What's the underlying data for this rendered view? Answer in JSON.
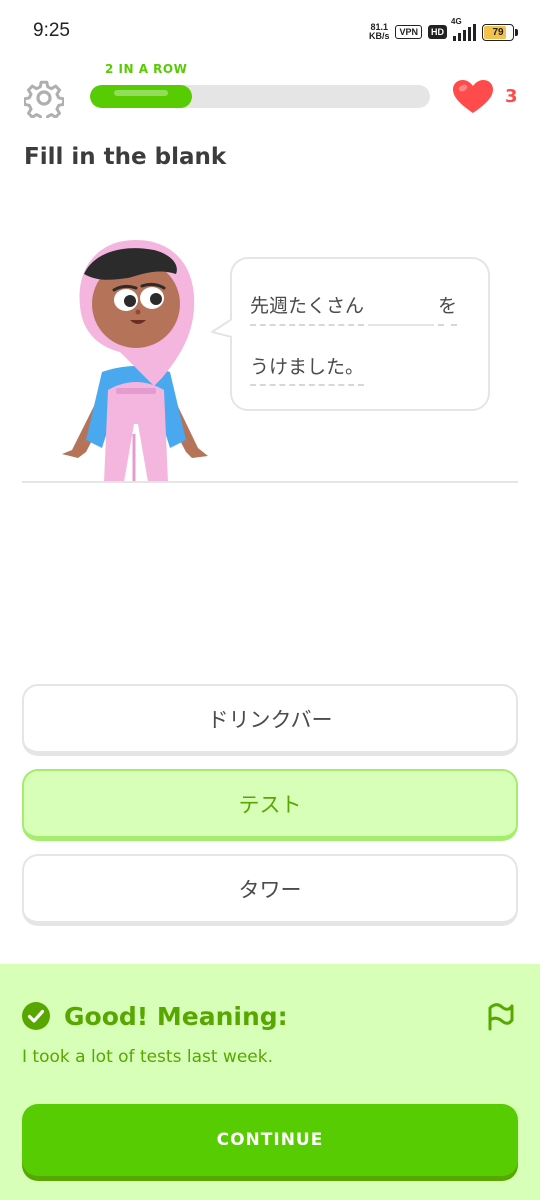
{
  "status_bar": {
    "time": "9:25",
    "net_speed_top": "81.1",
    "net_speed_bottom": "KB/s",
    "vpn": "VPN",
    "hd": "HD",
    "network": "4G",
    "battery": "79"
  },
  "lesson": {
    "streak_label": "2 IN A ROW",
    "progress": 0.3,
    "lives": "3",
    "title": "Fill in the blank"
  },
  "bubble": {
    "line1_before": "先週たくさん",
    "line1_after": "を",
    "line2": "うけました。"
  },
  "options": [
    {
      "label": "ドリンクバー",
      "selected": false
    },
    {
      "label": "テスト",
      "selected": true
    },
    {
      "label": "タワー",
      "selected": false
    }
  ],
  "feedback": {
    "title": "Good! Meaning:",
    "meaning": "I took a lot of tests last week.",
    "continue_label": "CONTINUE"
  },
  "colors": {
    "brand_green": "#58cc02",
    "feedback_bg": "#d7ffb8",
    "heart_red": "#ff4b4b"
  },
  "icons": [
    "gear-icon",
    "heart-icon",
    "check-circle-icon",
    "flag-icon"
  ]
}
